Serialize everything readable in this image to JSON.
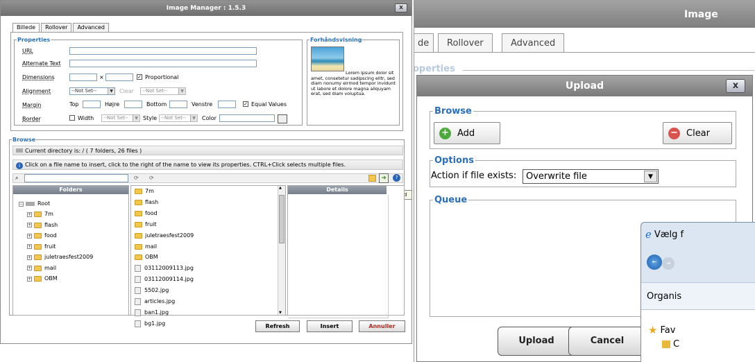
{
  "left": {
    "title": "Image Manager : 1.5.3",
    "close": "x",
    "tabs": [
      "Billede",
      "Rollover",
      "Advanced"
    ],
    "properties": {
      "legend": "Properties",
      "url_label": "URL",
      "alt_label": "Alternate Text",
      "dimensions_label": "Dimensions",
      "times": "×",
      "proportional": "Proportional",
      "alignment_label": "Alignment",
      "align_select": "--Not Set--",
      "clear_label": "Clear",
      "align_select2": "--Not Set--",
      "margin_label": "Margin",
      "top": "Top",
      "right": "Højre",
      "bottom": "Bottom",
      "leftm": "Venstre",
      "equal_values": "Equal Values",
      "border_label": "Border",
      "width": "Width",
      "width_select": "--Not Set--",
      "style": "Style",
      "style_select": "--Not Set--",
      "color": "Color"
    },
    "preview": {
      "legend": "Forhåndsvisning",
      "text": "Lorem ipsum dolor sit amet, consetetur sadipscing elitr, sed diam nonumy eirmod tempor invidunt ut labore et dolore magna aliquyam erat, sed diam voluptua."
    },
    "browse": {
      "legend": "Browse",
      "current_dir": "Current directory is: / ( 7 folders, 26 files )",
      "info": "Click on a file name to insert, click to the right of the name to view its properties. CTRL+Click selects multiple files.",
      "folders_header": "Folders",
      "details_header": "Details",
      "upload_tooltip": "Upload",
      "root": "Root",
      "tree": [
        "7m",
        "flash",
        "food",
        "fruit",
        "juletraesfest2009",
        "mail",
        "OBM"
      ],
      "files": [
        {
          "name": "7m",
          "kind": "folder"
        },
        {
          "name": "flash",
          "kind": "folder"
        },
        {
          "name": "food",
          "kind": "folder"
        },
        {
          "name": "fruit",
          "kind": "folder"
        },
        {
          "name": "juletraesfest2009",
          "kind": "folder"
        },
        {
          "name": "mail",
          "kind": "folder"
        },
        {
          "name": "OBM",
          "kind": "folder"
        },
        {
          "name": "03112009113.jpg",
          "kind": "file"
        },
        {
          "name": "03112009114.jpg",
          "kind": "file"
        },
        {
          "name": "5502.jpg",
          "kind": "file"
        },
        {
          "name": "articles.jpg",
          "kind": "file"
        },
        {
          "name": "ban1.jpg",
          "kind": "file"
        },
        {
          "name": "bg1.jpg",
          "kind": "file"
        }
      ]
    },
    "buttons": {
      "refresh": "Refresh",
      "insert": "Insert",
      "cancel": "Annuller"
    }
  },
  "right": {
    "title_partial": "Image Manag",
    "tabs_partial": [
      "de",
      "Rollover",
      "Advanced"
    ],
    "props_partial": "operties",
    "upload": {
      "title": "Upload",
      "close": "x",
      "browse_legend": "Browse",
      "add": "Add",
      "clear": "Clear",
      "options_legend": "Options",
      "action_label": "Action if file exists:",
      "action_value": "Overwrite file",
      "queue_legend": "Queue",
      "upload_btn": "Upload",
      "cancel_btn": "Cancel"
    },
    "win7": {
      "title": "Vælg f",
      "organise": "Organis",
      "fav": "Fav",
      "item": "C"
    }
  },
  "colors": {
    "legend_blue": "#2b6fb8",
    "add_green": "#4caa3c",
    "clear_red": "#d9534f",
    "cancel_red": "#c0392b"
  }
}
